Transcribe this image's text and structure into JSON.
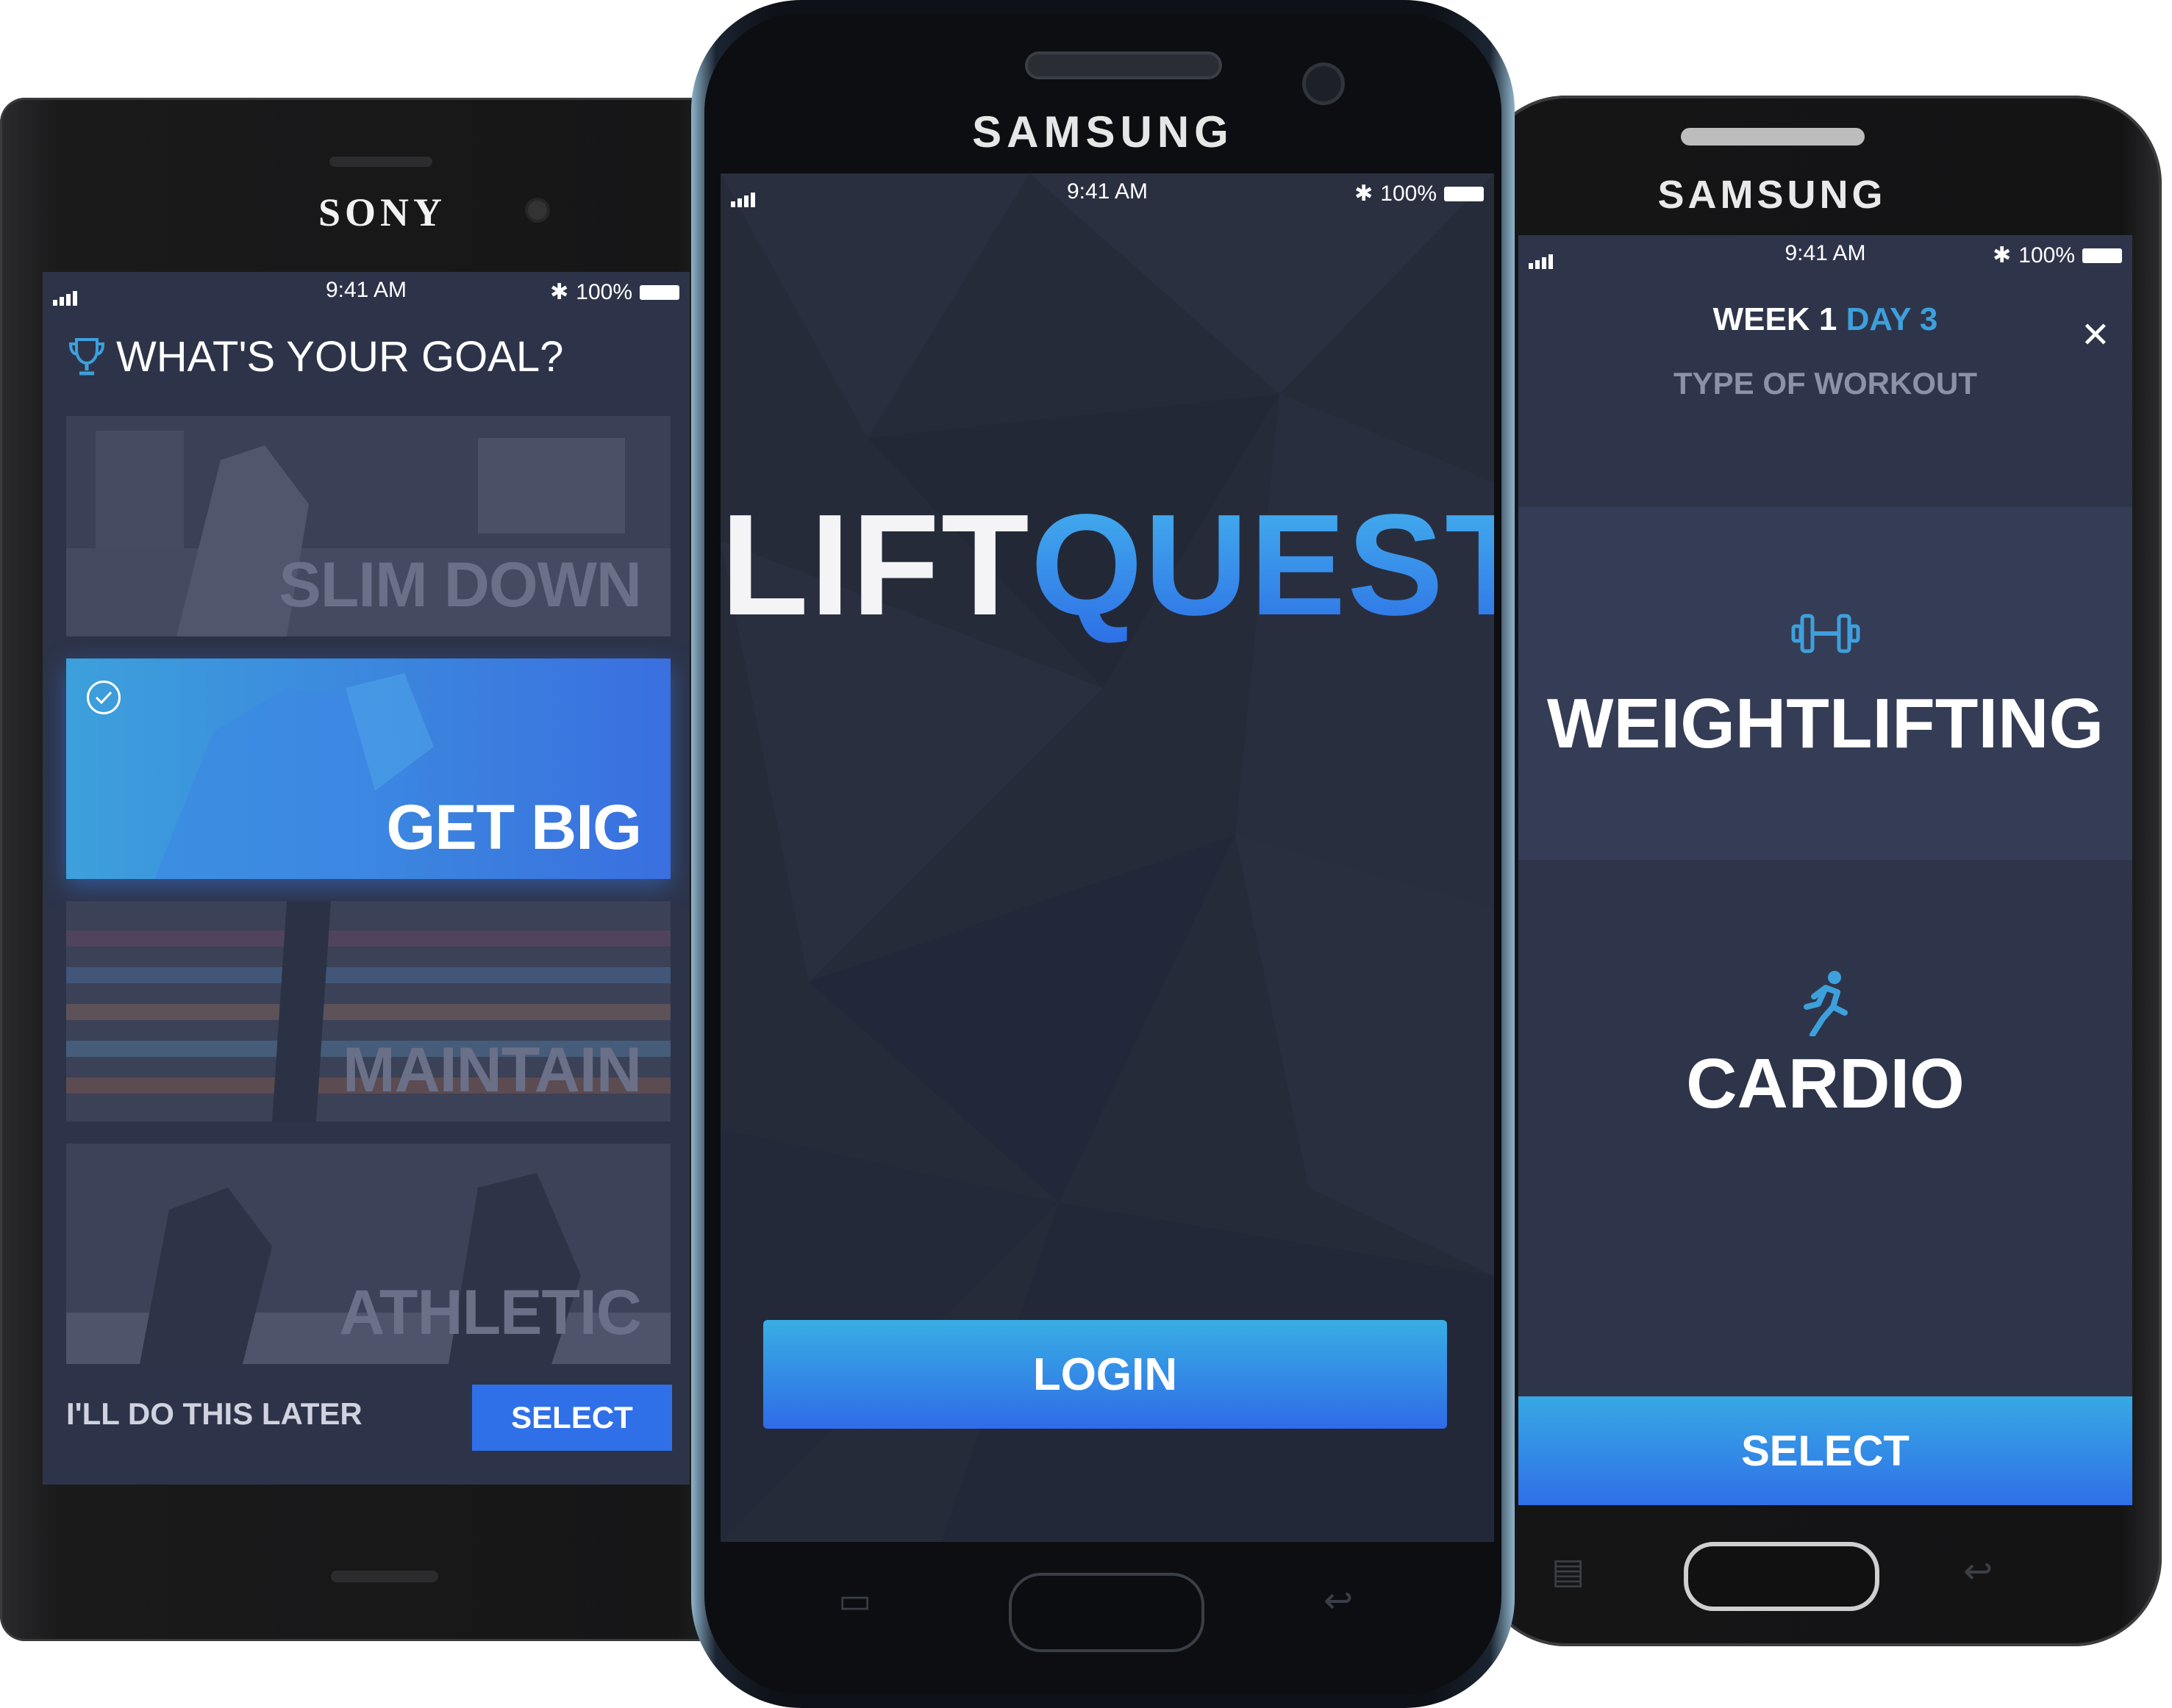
{
  "left_phone": {
    "brand": "SONY",
    "status": {
      "time": "9:41 AM",
      "battery": "100%"
    },
    "title": "WHAT'S YOUR GOAL?",
    "goals": [
      {
        "label": "SLIM DOWN",
        "selected": false
      },
      {
        "label": "GET BIG",
        "selected": true
      },
      {
        "label": "MAINTAIN",
        "selected": false
      },
      {
        "label": "ATHLETIC",
        "selected": false
      }
    ],
    "later_link": "I'LL DO THIS LATER",
    "select_button": "SELECT",
    "icons": {
      "trophy": "trophy-icon",
      "check": "check-circle-icon"
    }
  },
  "center_phone": {
    "brand": "SAMSUNG",
    "status": {
      "time": "9:41 AM",
      "battery": "100%"
    },
    "logo_part1": "LIFT",
    "logo_part2": "QUEST",
    "login_button": "LOGIN"
  },
  "right_phone": {
    "brand": "SAMSUNG",
    "status": {
      "time": "9:41 AM",
      "battery": "100%"
    },
    "week": "WEEK 1",
    "day": "DAY 3",
    "subtitle": "TYPE OF WORKOUT",
    "options": [
      {
        "label": "WEIGHTLIFTING",
        "icon": "dumbbell-icon",
        "selected": true
      },
      {
        "label": "CARDIO",
        "icon": "runner-icon",
        "selected": false
      }
    ],
    "select_button": "SELECT"
  },
  "colors": {
    "accent": "#2f6fe8",
    "accent_light": "#3da0dc",
    "screen_bg": "#2d3449",
    "muted_text": "#8c91a6"
  }
}
